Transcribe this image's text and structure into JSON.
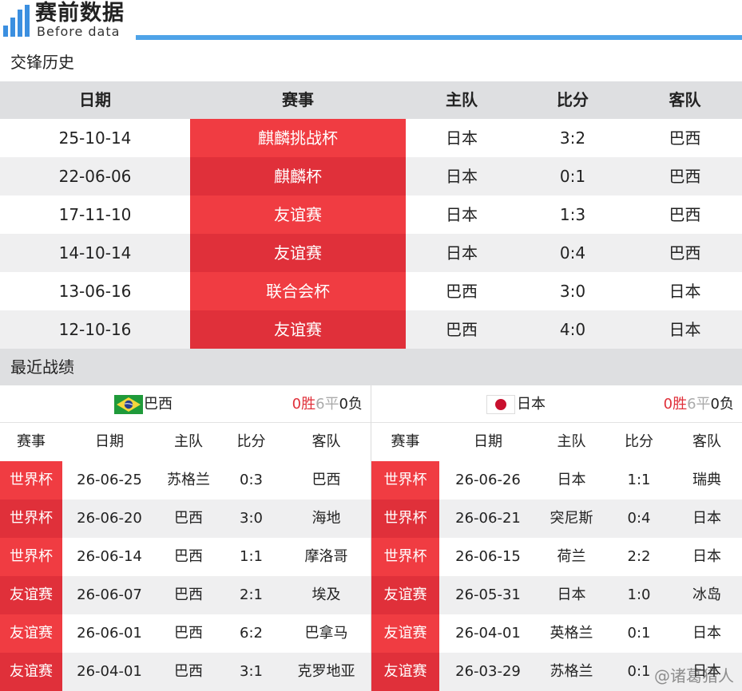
{
  "logo": {
    "title": "赛前数据",
    "subtitle": "Before data"
  },
  "h2h": {
    "section_title": "交锋历史",
    "columns": [
      "日期",
      "赛事",
      "主队",
      "比分",
      "客队"
    ],
    "rows": [
      [
        "25-10-14",
        "麒麟挑战杯",
        "日本",
        "3:2",
        "巴西"
      ],
      [
        "22-06-06",
        "麒麟杯",
        "日本",
        "0:1",
        "巴西"
      ],
      [
        "17-11-10",
        "友谊赛",
        "日本",
        "1:3",
        "巴西"
      ],
      [
        "14-10-14",
        "友谊赛",
        "日本",
        "0:4",
        "巴西"
      ],
      [
        "13-06-16",
        "联合会杯",
        "巴西",
        "3:0",
        "日本"
      ],
      [
        "12-10-16",
        "友谊赛",
        "巴西",
        "4:0",
        "日本"
      ]
    ]
  },
  "recent": {
    "section_title": "最近战绩",
    "columns": [
      "赛事",
      "日期",
      "主队",
      "比分",
      "客队"
    ],
    "left": {
      "team": "巴西",
      "flag": "brazil-flag",
      "record": {
        "win": "0胜",
        "draw": "6平",
        "loss": "0负"
      },
      "rows": [
        [
          "世界杯",
          "26-06-25",
          "苏格兰",
          "0:3",
          "巴西"
        ],
        [
          "世界杯",
          "26-06-20",
          "巴西",
          "3:0",
          "海地"
        ],
        [
          "世界杯",
          "26-06-14",
          "巴西",
          "1:1",
          "摩洛哥"
        ],
        [
          "友谊赛",
          "26-06-07",
          "巴西",
          "2:1",
          "埃及"
        ],
        [
          "友谊赛",
          "26-06-01",
          "巴西",
          "6:2",
          "巴拿马"
        ],
        [
          "友谊赛",
          "26-04-01",
          "巴西",
          "3:1",
          "克罗地亚"
        ]
      ]
    },
    "right": {
      "team": "日本",
      "flag": "japan-flag",
      "record": {
        "win": "0胜",
        "draw": "6平",
        "loss": "0负"
      },
      "rows": [
        [
          "世界杯",
          "26-06-26",
          "日本",
          "1:1",
          "瑞典"
        ],
        [
          "世界杯",
          "26-06-21",
          "突尼斯",
          "0:4",
          "日本"
        ],
        [
          "世界杯",
          "26-06-15",
          "荷兰",
          "2:2",
          "日本"
        ],
        [
          "友谊赛",
          "26-05-31",
          "日本",
          "1:0",
          "冰岛"
        ],
        [
          "友谊赛",
          "26-04-01",
          "英格兰",
          "0:1",
          "日本"
        ],
        [
          "友谊赛",
          "26-03-29",
          "苏格兰",
          "0:1",
          "日本"
        ]
      ]
    }
  },
  "watermark": "@诸葛猎人",
  "colors": {
    "accent_red": "#f03c42",
    "accent_red_dark": "#e0303a",
    "header_gray": "#dedfe1",
    "logo_blue": "#3b8fe0"
  }
}
